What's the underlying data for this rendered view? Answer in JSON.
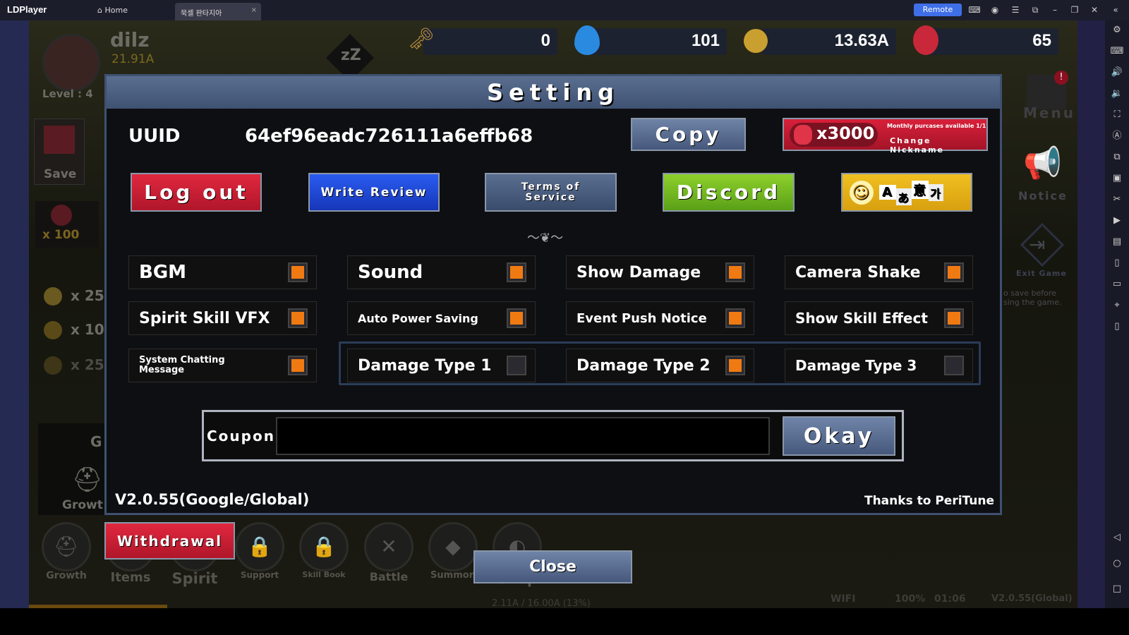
{
  "titlebar": {
    "app": "LDPlayer",
    "tabs": [
      {
        "label": "Home",
        "icon": "home-icon"
      },
      {
        "label": "묵셀 판타지아",
        "close": "×"
      }
    ],
    "remote": "Remote"
  },
  "hud": {
    "player_name": "dilz",
    "power": "21.91A",
    "level": "Level : 4",
    "keys": "0",
    "water": "101",
    "gold": "13.63A",
    "gems": "65",
    "sleep": "zZ"
  },
  "left_panel": {
    "save": "Save",
    "gem_reward": "x 100",
    "rewards": [
      "x 25",
      "x 10",
      "x 25"
    ],
    "growth_tab": "G",
    "growth": "Growt"
  },
  "right_panel": {
    "menu": "Menu",
    "notice": "Notice",
    "exit_game": "Exit Game",
    "exit_hint": "o save before\nsing the game."
  },
  "setting": {
    "title": "Setting",
    "uuid_label": "UUID",
    "uuid": "64ef96eadc726111a6effb68",
    "copy": "Copy",
    "nickname": {
      "gems": "x3000",
      "note": "Monthly purcases available 1/1",
      "label": "Change Nickname"
    },
    "buttons": {
      "logout": "Log out",
      "review": "Write Review",
      "terms": "Terms of Service",
      "discord": "Discord"
    },
    "language_icon": [
      "A",
      "あ",
      "意",
      "가"
    ],
    "options": [
      {
        "label": "BGM",
        "on": true
      },
      {
        "label": "Sound",
        "on": true
      },
      {
        "label": "Show Damage",
        "on": true
      },
      {
        "label": "Camera Shake",
        "on": true
      },
      {
        "label": "Spirit Skill VFX",
        "on": true
      },
      {
        "label": "Auto Power Saving",
        "on": true
      },
      {
        "label": "Event Push Notice",
        "on": true
      },
      {
        "label": "Show Skill Effect",
        "on": true
      },
      {
        "label": "System Chatting Message",
        "on": true
      },
      {
        "label": "Damage Type 1",
        "on": false
      },
      {
        "label": "Damage Type 2",
        "on": true
      },
      {
        "label": "Damage Type 3",
        "on": false
      }
    ],
    "coupon_label": "Coupon",
    "coupon_value": "",
    "okay": "Okay",
    "version": "V2.0.55(Google/Global)",
    "thanks": "Thanks to PeriTune"
  },
  "withdrawal": "Withdrawal",
  "close": "Close",
  "bottom_nav": [
    "Growth",
    "Items",
    "Spirit",
    "Support",
    "Skill Book",
    "Battle",
    "Summon",
    "Shop"
  ],
  "status": {
    "wifi": "WIFI",
    "battery": "100%",
    "time": "01:06",
    "version": "V2.0.55(Global)",
    "exp": "2.11A / 16.00A (13%)"
  },
  "colors": {
    "accent_orange": "#f07a12",
    "logout": "#d8203a",
    "review": "#1f4fe0",
    "discord": "#7cc322",
    "lang": "#e7b31a"
  }
}
